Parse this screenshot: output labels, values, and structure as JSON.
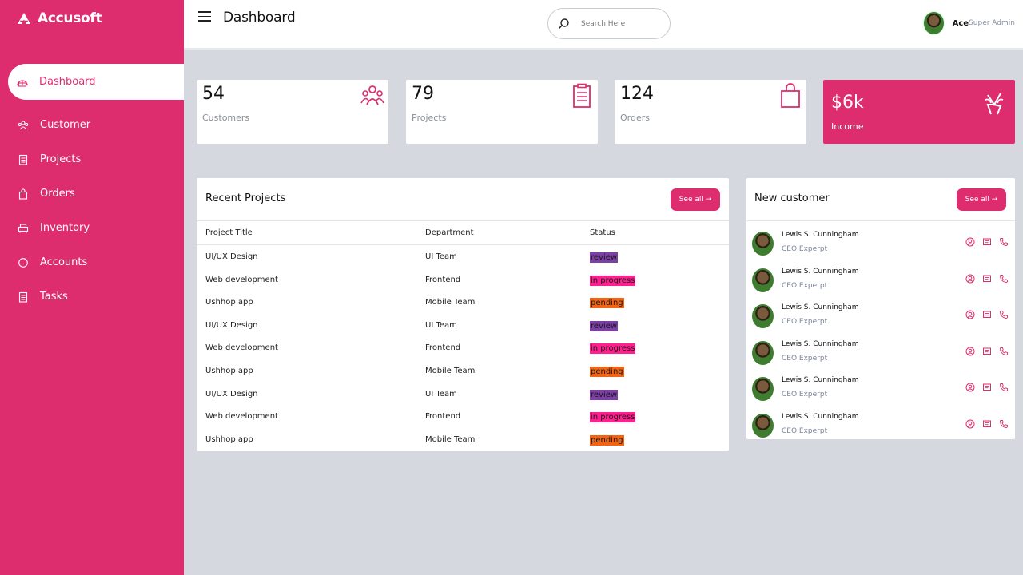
{
  "brand": {
    "name": "Accusoft",
    "icon": "logo-icon"
  },
  "sidebar": {
    "items": [
      {
        "label": "Dashboard",
        "icon": "dashboard-icon",
        "active": true
      },
      {
        "label": "Customer",
        "icon": "customers-icon"
      },
      {
        "label": "Projects",
        "icon": "clipboard-icon"
      },
      {
        "label": "Orders",
        "icon": "shopping-bag-icon"
      },
      {
        "label": "Inventory",
        "icon": "inventory-icon"
      },
      {
        "label": "Accounts",
        "icon": "circle-icon"
      },
      {
        "label": "Tasks",
        "icon": "clipboard-icon"
      }
    ]
  },
  "header": {
    "title": "Dashboard",
    "search_placeholder": "Search Here",
    "user": {
      "name": "Ace",
      "role": "Super Admin"
    }
  },
  "stats": [
    {
      "value": "54",
      "label": "Customers",
      "icon": "customers-icon"
    },
    {
      "value": "79",
      "label": "Projects",
      "icon": "clipboard-icon"
    },
    {
      "value": "124",
      "label": "Orders",
      "icon": "shopping-bag-icon"
    },
    {
      "value": "$6k",
      "label": "Income",
      "icon": "wallet-icon"
    }
  ],
  "projects": {
    "title": "Recent Projects",
    "see_all": "See all →",
    "columns": [
      "Project Title",
      "Department",
      "Status"
    ],
    "rows": [
      {
        "title": "UI/UX Design",
        "department": "UI Team",
        "status": "review"
      },
      {
        "title": "Web development",
        "department": "Frontend",
        "status": "in progress"
      },
      {
        "title": "Ushhop app",
        "department": "Mobile Team",
        "status": "pending"
      },
      {
        "title": "UI/UX Design",
        "department": "UI Team",
        "status": "review"
      },
      {
        "title": "Web development",
        "department": "Frontend",
        "status": "in progress"
      },
      {
        "title": "Ushhop app",
        "department": "Mobile Team",
        "status": "pending"
      },
      {
        "title": "UI/UX Design",
        "department": "UI Team",
        "status": "review"
      },
      {
        "title": "Web development",
        "department": "Frontend",
        "status": "in progress"
      },
      {
        "title": "Ushhop app",
        "department": "Mobile Team",
        "status": "pending"
      }
    ],
    "status_colors": {
      "review": "#7b3fa6",
      "in progress": "#ff1f8e",
      "pending": "#f26313"
    }
  },
  "customers": {
    "title": "New customer",
    "see_all": "See all →",
    "list": [
      {
        "name": "Lewis S. Cunningham",
        "role": "CEO Experpt"
      },
      {
        "name": "Lewis S. Cunningham",
        "role": "CEO Experpt"
      },
      {
        "name": "Lewis S. Cunningham",
        "role": "CEO Experpt"
      },
      {
        "name": "Lewis S. Cunningham",
        "role": "CEO Experpt"
      },
      {
        "name": "Lewis S. Cunningham",
        "role": "CEO Experpt"
      },
      {
        "name": "Lewis S. Cunningham",
        "role": "CEO Experpt"
      }
    ],
    "actions": [
      "user-icon",
      "message-icon",
      "phone-icon"
    ]
  },
  "colors": {
    "accent": "#de2d6e",
    "background": "#d5d8de"
  }
}
